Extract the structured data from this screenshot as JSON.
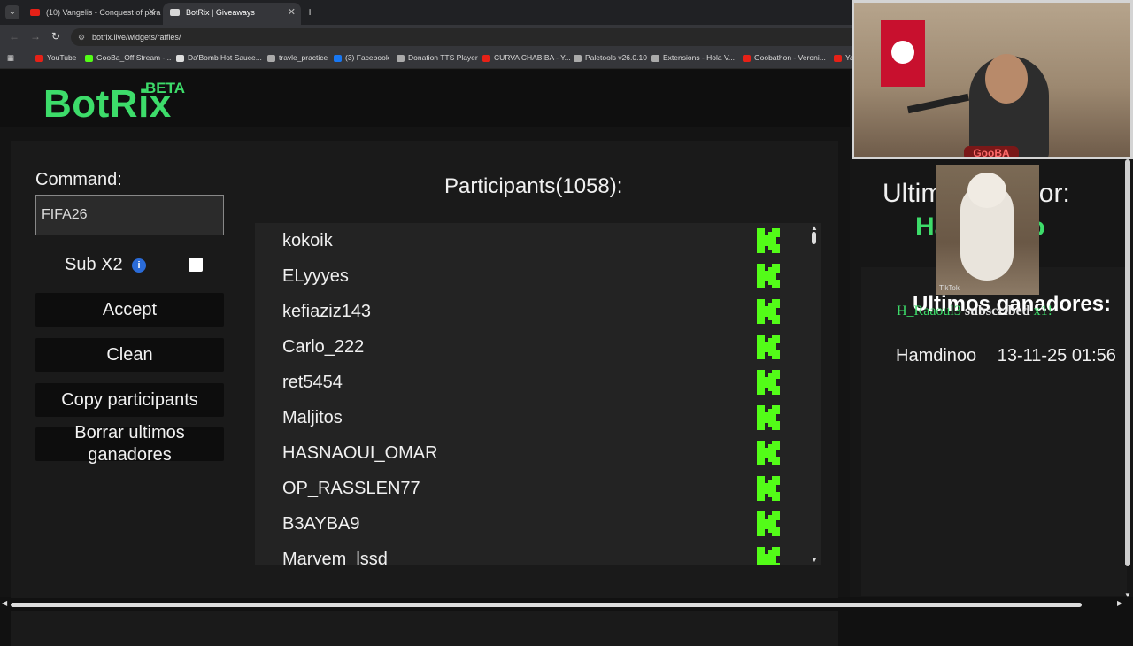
{
  "browser": {
    "tabs": [
      {
        "title": "(10) Vangelis - Conquest of para",
        "fav_color": "#e62117"
      },
      {
        "title": "BotRix | Giveaways",
        "fav_color": "#d8d8d8"
      }
    ],
    "url": "botrix.live/widgets/raffles/",
    "bookmarks": [
      {
        "label": "YouTube",
        "color": "#e62117"
      },
      {
        "label": "GooBa_Off Stream -...",
        "color": "#53fc18"
      },
      {
        "label": "Da'Bomb Hot Sauce...",
        "color": "#dddddd"
      },
      {
        "label": "travle_practice",
        "color": "#aaaaaa"
      },
      {
        "label": "(3) Facebook",
        "color": "#1877f2"
      },
      {
        "label": "Donation TTS Player",
        "color": "#aaaaaa"
      },
      {
        "label": "CURVA CHABIBA - Y...",
        "color": "#e62117"
      },
      {
        "label": "Paletools v26.0.10",
        "color": "#aaaaaa"
      },
      {
        "label": "Extensions - Hola V...",
        "color": "#aaaaaa"
      },
      {
        "label": "Goobathon - Veroni...",
        "color": "#e62117"
      },
      {
        "label": "Ya",
        "color": "#e62117"
      }
    ]
  },
  "app": {
    "logo": "BotRix",
    "logo_badge": "BETA"
  },
  "controls": {
    "command_label": "Command:",
    "command_value": "FIFA26",
    "sub_label": "Sub X2",
    "info_glyph": "i",
    "accept_label": "Accept",
    "clean_label": "Clean",
    "copy_label": "Copy participants",
    "clear_winners_label": "Borrar ultimos ganadores"
  },
  "participants": {
    "title": "Participants(1058):",
    "names": [
      "kokoik",
      "ELyyyes",
      "kefiaziz143",
      "Carlo_222",
      "ret5454",
      "Maljitos",
      "HASNAOUI_OMAR",
      "OP_RASSLEN77",
      "B3AYBA9",
      "Maryem_lssd"
    ]
  },
  "winner": {
    "title": "Ultimo ganador:",
    "name": "Hamdinoo",
    "last_title": "Ultimos ganadores:",
    "history": [
      {
        "name": "Hamdinoo",
        "date": "13-11-25 01:56"
      }
    ]
  },
  "overlay": {
    "sub_notice_user": "H_Raaoul3",
    "sub_notice_msg": "subscribed",
    "sub_notice_count": "x1!",
    "webcam_badge": "GooBA",
    "tiktok": "TikTok"
  },
  "colors": {
    "accent": "#3ddc6a",
    "kick": "#53fc18"
  }
}
